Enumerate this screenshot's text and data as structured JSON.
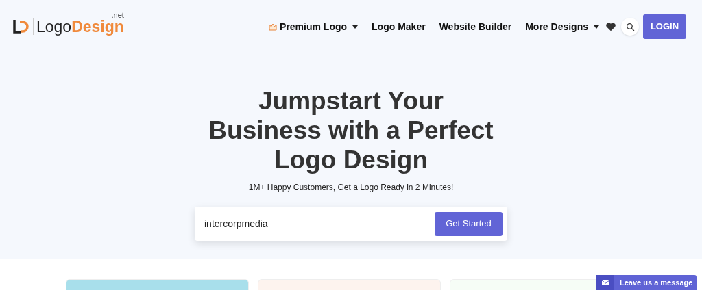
{
  "logo": {
    "word_1": "Logo",
    "word_2": "Design",
    "suffix": ".net"
  },
  "nav": [
    {
      "label": "Premium Logo",
      "kind": "dropdown",
      "crown": true
    },
    {
      "label": "Logo Maker",
      "kind": "link",
      "crown": false
    },
    {
      "label": "Website Builder",
      "kind": "link",
      "crown": false
    },
    {
      "label": "More Designs",
      "kind": "dropdown",
      "crown": false
    }
  ],
  "login": "LOGIN",
  "hero": {
    "headline_lines": [
      "Jumpstart Your",
      "Business with a Perfect",
      "Logo Design"
    ],
    "subtitle": "1M+ Happy Customers, Get a Logo Ready in 2 Minutes!",
    "search_value": "intercorpmedia",
    "cta": "Get Started"
  },
  "cards": [
    {
      "color": "#a8dfeb"
    },
    {
      "color": "#fdf3ee"
    },
    {
      "color": "#f6fdf6"
    }
  ],
  "chat": {
    "label": "Leave us a message"
  }
}
